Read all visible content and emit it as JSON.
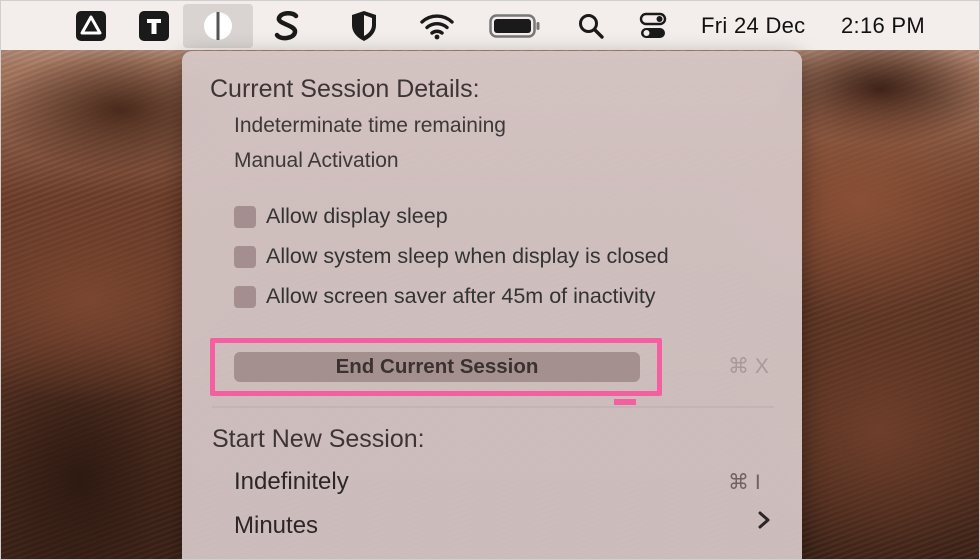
{
  "menubar": {
    "icons": [
      "drive-icon",
      "typora-icon",
      "amphetamine-icon",
      "scrivener-icon",
      "shield-icon",
      "wifi-icon",
      "battery-icon",
      "spotlight-icon",
      "control-center-icon"
    ],
    "date": "Fri 24 Dec",
    "time": "2:16 PM"
  },
  "menu": {
    "current_header": "Current Session Details:",
    "time_remaining": "Indeterminate time remaining",
    "activation": "Manual Activation",
    "options": [
      {
        "label": "Allow display sleep",
        "checked": false
      },
      {
        "label": "Allow system sleep when display is closed",
        "checked": false
      },
      {
        "label": "Allow screen saver after 45m of inactivity",
        "checked": false
      }
    ],
    "end_button": "End Current Session",
    "end_shortcut": "⌘ X",
    "new_header": "Start New Session:",
    "indefinitely": "Indefinitely",
    "indefinitely_shortcut": "⌘ I",
    "minutes": "Minutes"
  },
  "colors": {
    "highlight": "#f35fa0",
    "menu_bg": "#d6c8c8"
  }
}
